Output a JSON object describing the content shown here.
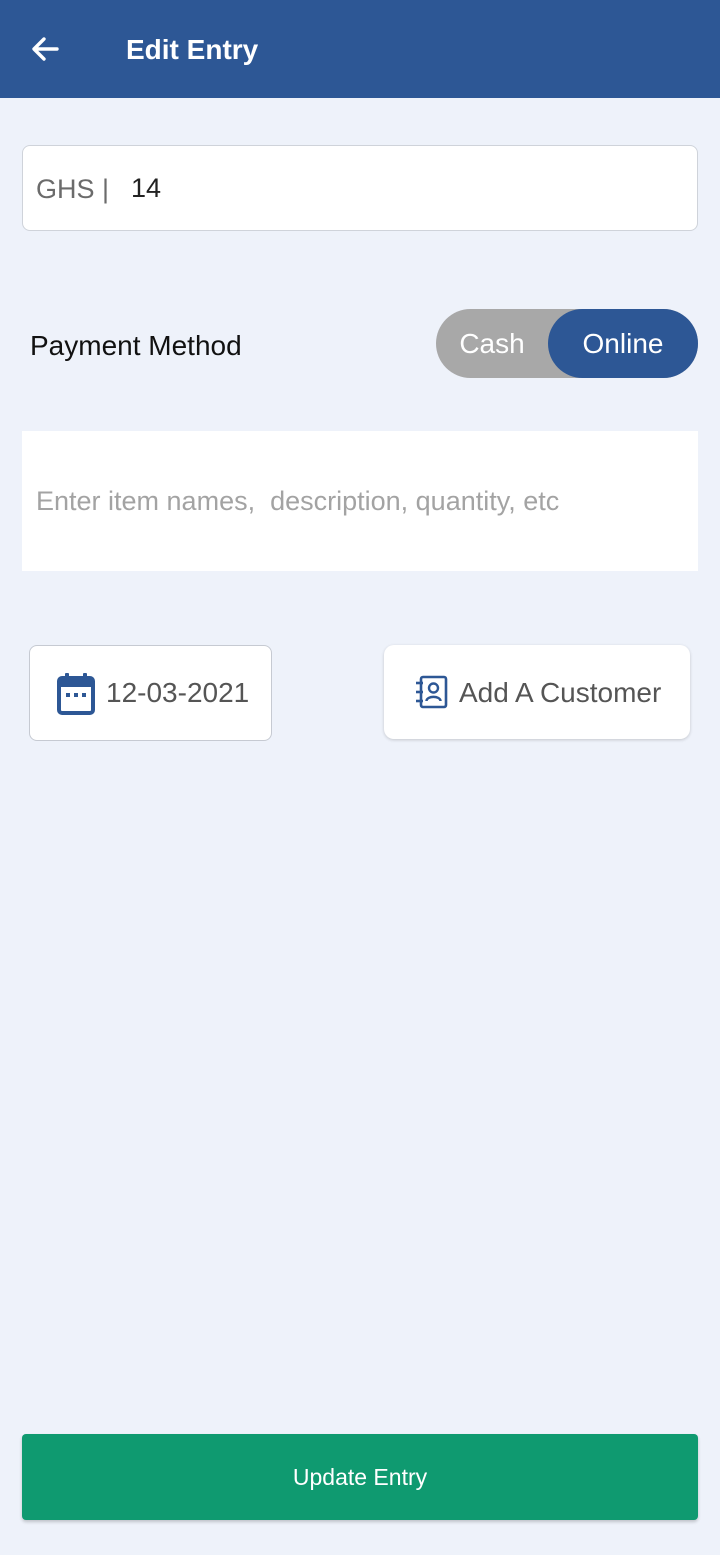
{
  "header": {
    "title": "Edit Entry",
    "back_icon": "arrow-left-icon",
    "background": "#2d5795"
  },
  "amount": {
    "currency_label": "GHS |",
    "value": "14"
  },
  "payment_method": {
    "label": "Payment Method",
    "options": [
      "Cash",
      "Online"
    ],
    "selected": "Online"
  },
  "description": {
    "value": "",
    "placeholder": "Enter item names,  description, quantity, etc"
  },
  "date_picker": {
    "icon": "calendar-icon",
    "value": "12-03-2021"
  },
  "customer": {
    "icon": "contact-book-icon",
    "label": "Add A Customer"
  },
  "footer": {
    "update_label": "Update Entry",
    "accent": "#0f9a70"
  }
}
